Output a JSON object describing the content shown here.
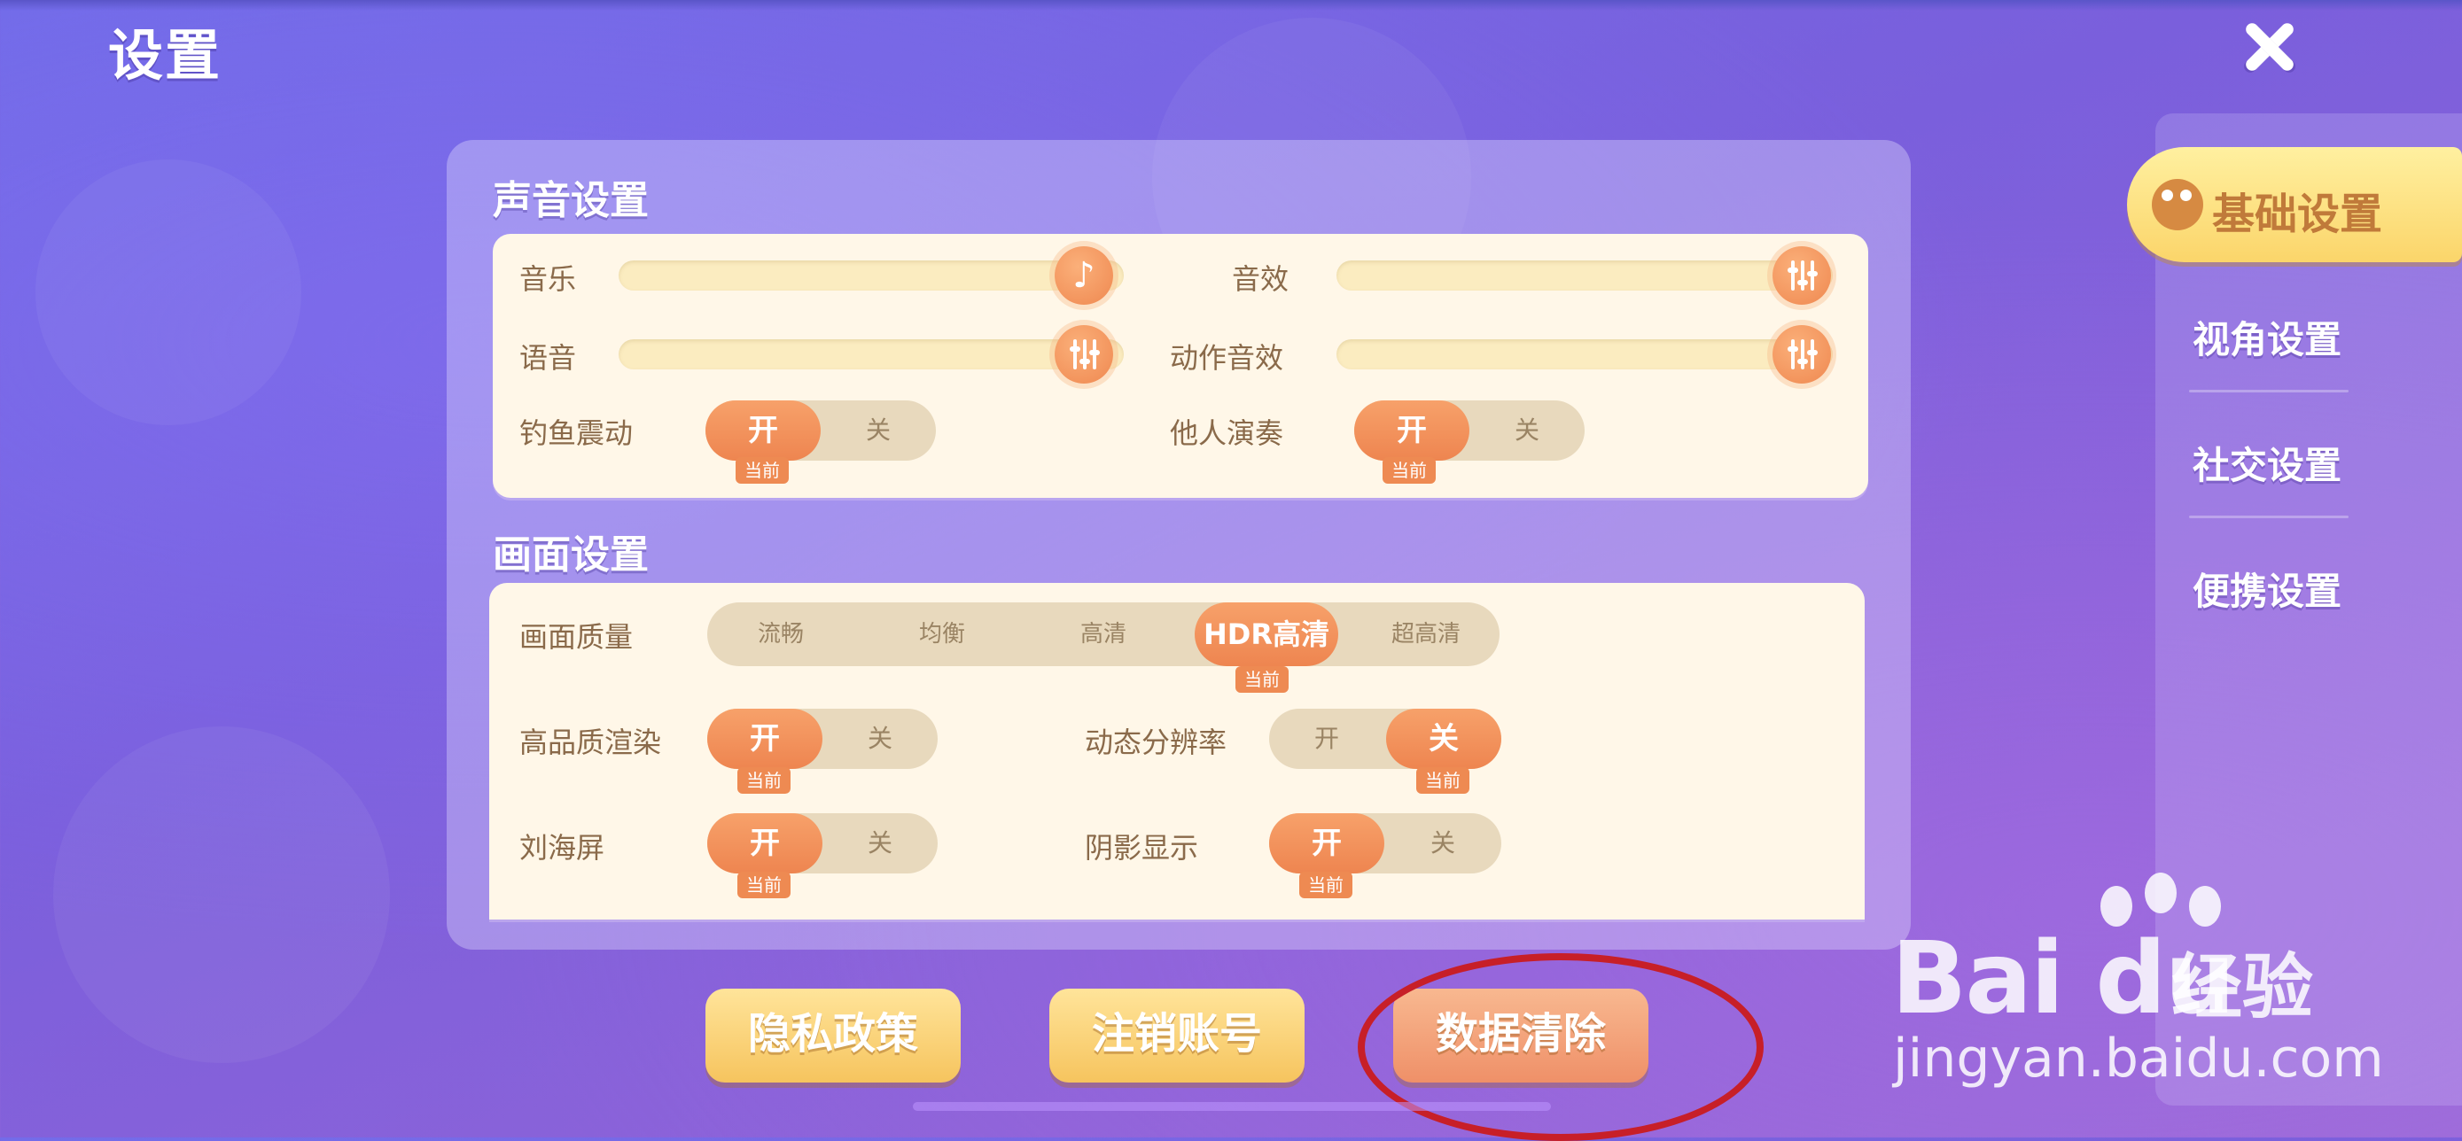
{
  "header": {
    "title": "设置"
  },
  "sound": {
    "title": "声音设置",
    "music_label": "音乐",
    "music_level": 1.0,
    "sfx_label": "音效",
    "sfx_level": 1.0,
    "voice_label": "语音",
    "voice_level": 1.0,
    "action_sfx_label": "动作音效",
    "action_sfx_level": 1.0,
    "fishing_vibration": {
      "label": "钓鱼震动",
      "on": "开",
      "off": "关",
      "current": "当前",
      "value": "on"
    },
    "others_play": {
      "label": "他人演奏",
      "on": "开",
      "off": "关",
      "current": "当前",
      "value": "on"
    }
  },
  "graphics": {
    "title": "画面设置",
    "quality": {
      "label": "画面质量",
      "options": [
        "流畅",
        "均衡",
        "高清",
        "HDR高清",
        "超高清"
      ],
      "selected": "HDR高清",
      "current": "当前"
    },
    "hq_render": {
      "label": "高品质渲染",
      "on": "开",
      "off": "关",
      "current": "当前",
      "value": "on"
    },
    "dynamic_res": {
      "label": "动态分辨率",
      "on": "开",
      "off": "关",
      "current": "当前",
      "value": "off"
    },
    "notch": {
      "label": "刘海屏",
      "on": "开",
      "off": "关",
      "current": "当前",
      "value": "on"
    },
    "shadow": {
      "label": "阴影显示",
      "on": "开",
      "off": "关",
      "current": "当前",
      "value": "on"
    }
  },
  "sidebar": {
    "items": [
      {
        "label": "基础设置",
        "active": true
      },
      {
        "label": "视角设置",
        "active": false
      },
      {
        "label": "社交设置",
        "active": false
      },
      {
        "label": "便携设置",
        "active": false
      }
    ]
  },
  "footer": {
    "privacy": "隐私政策",
    "logout": "注销账号",
    "clear_data": "数据清除"
  },
  "watermark": {
    "logo": "Bai du",
    "cn": "经验",
    "url": "jingyan.baidu.com"
  },
  "colors": {
    "accent": "#ee8550",
    "annotation": "#c71f28"
  }
}
